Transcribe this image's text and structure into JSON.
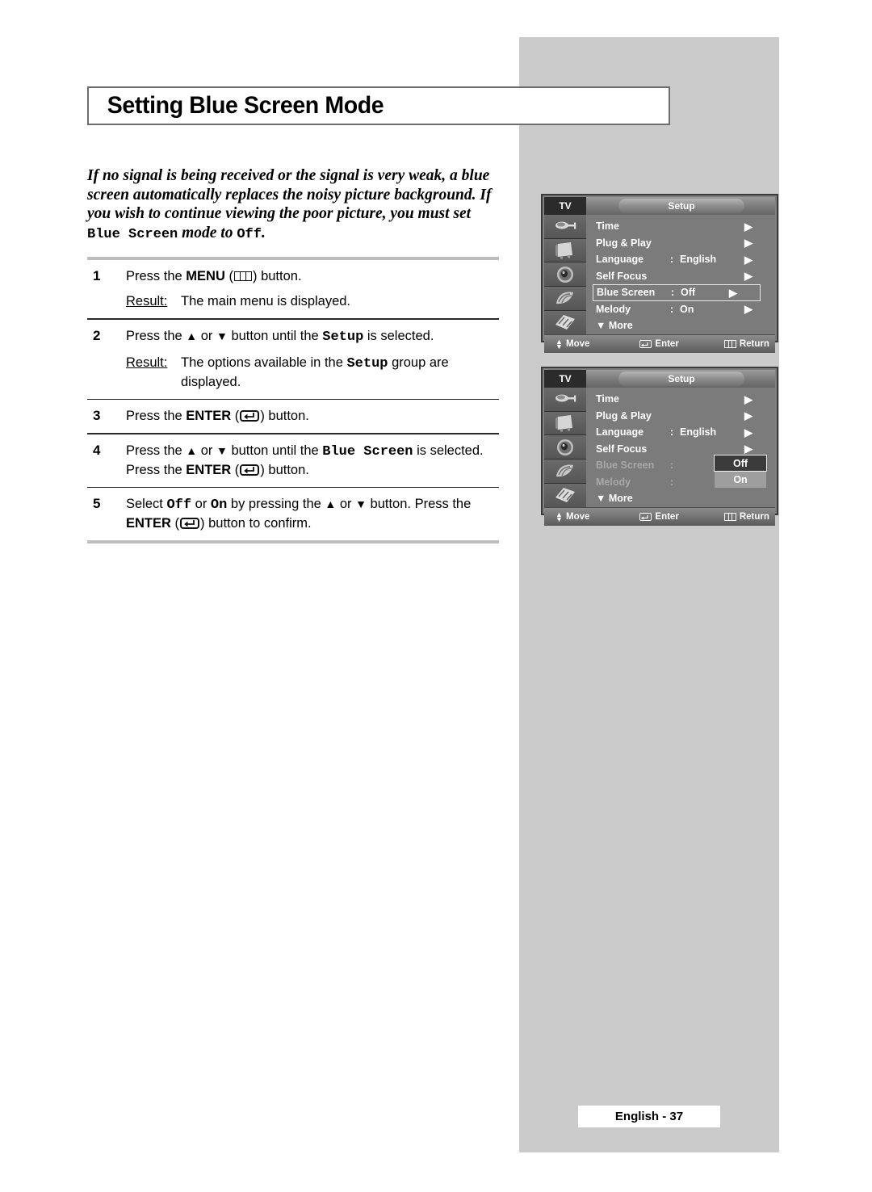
{
  "page": {
    "title": "Setting Blue Screen Mode",
    "footer_label": "English - 37"
  },
  "intro": {
    "part1": "If no signal is being received or the signal is very weak, a blue screen automatically replaces the noisy picture background. If you wish to continue viewing the poor picture, you must set ",
    "mono1": "Blue Screen",
    "part2": " mode to ",
    "mono2": "Off",
    "part3": "."
  },
  "steps": [
    {
      "num": "1",
      "line_a": "Press the ",
      "line_a_bold": "MENU",
      "line_a_icon": "menu-icon",
      "line_a_tail": " button.",
      "result_label": "Result:",
      "result_text": "The main menu is displayed."
    },
    {
      "num": "2",
      "pre": "Press the ",
      "up": "▲",
      "mid": " or ",
      "down": "▼",
      "post": " button until the ",
      "mono": "Setup",
      "tail": " is selected.",
      "result_label": "Result:",
      "result_pre": "The options available in the ",
      "result_mono": "Setup",
      "result_post": " group are displayed."
    },
    {
      "num": "3",
      "pre": "Press the ",
      "bold": "ENTER",
      "icon": "enter-icon",
      "tail": " button."
    },
    {
      "num": "4",
      "pre": "Press the ",
      "up": "▲",
      "mid": " or ",
      "down": "▼",
      "post": " button until the ",
      "mono": "Blue Screen",
      "tail": " is selected.",
      "line2_pre": "Press the ",
      "line2_bold": "ENTER",
      "line2_icon": "enter-icon",
      "line2_tail": " button."
    },
    {
      "num": "5",
      "pre": "Select ",
      "mono1": "Off",
      "mid1": " or ",
      "mono2": "On",
      "mid2": "  by pressing the ",
      "up": "▲",
      "mid3": " or ",
      "down": "▼",
      "post": " button. Press the",
      "line2_bold": "ENTER",
      "line2_icon": "enter-icon",
      "line2_tail": " button to confirm."
    }
  ],
  "osd": {
    "tv_label": "TV",
    "menu_title": "Setup",
    "caret": "▶",
    "more_arrow": "▼",
    "more_label": "More",
    "colon": ":",
    "footer": {
      "move": "Move",
      "enter": "Enter",
      "return": "Return"
    },
    "sidebar_icons": [
      "antenna-icon",
      "picture-icon",
      "sound-icon",
      "feature-icon",
      "setup-icon"
    ],
    "screen1": {
      "rows": [
        {
          "label": "Time",
          "value": "",
          "has_value": false,
          "selected": false,
          "dim": false
        },
        {
          "label": "Plug & Play",
          "value": "",
          "has_value": false,
          "selected": false,
          "dim": false
        },
        {
          "label": "Language",
          "value": "English",
          "has_value": true,
          "selected": false,
          "dim": false
        },
        {
          "label": "Self Focus",
          "value": "",
          "has_value": false,
          "selected": false,
          "dim": false
        },
        {
          "label": "Blue Screen",
          "value": "Off",
          "has_value": true,
          "selected": true,
          "dim": false
        },
        {
          "label": "Melody",
          "value": "On",
          "has_value": true,
          "selected": false,
          "dim": false
        }
      ]
    },
    "screen2": {
      "rows": [
        {
          "label": "Time",
          "value": "",
          "has_value": false,
          "selected": false,
          "dim": false
        },
        {
          "label": "Plug & Play",
          "value": "",
          "has_value": false,
          "selected": false,
          "dim": false
        },
        {
          "label": "Language",
          "value": "English",
          "has_value": true,
          "selected": false,
          "dim": false
        },
        {
          "label": "Self Focus",
          "value": "",
          "has_value": false,
          "selected": false,
          "dim": false
        },
        {
          "label": "Blue Screen",
          "value": "",
          "has_value": true,
          "selected": false,
          "dim": true
        },
        {
          "label": "Melody",
          "value": "",
          "has_value": true,
          "selected": false,
          "dim": true
        }
      ],
      "dropdown": {
        "options": [
          {
            "label": "Off",
            "state": "active"
          },
          {
            "label": "On",
            "state": "inactive"
          }
        ]
      }
    }
  },
  "colors": {
    "panel_gray": "#cbcbcb",
    "rule_gray": "#bdbdbd",
    "osd_bg": "#7b7b7b",
    "osd_sidebar": "#5d5d5d",
    "title_border": "#6d6d6d"
  }
}
